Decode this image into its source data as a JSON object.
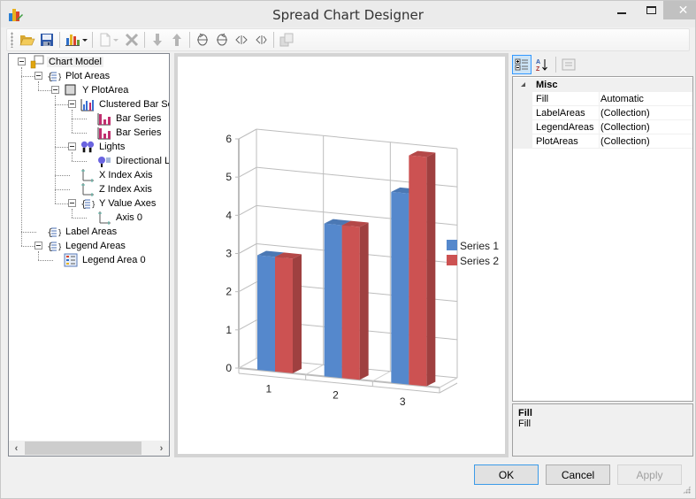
{
  "window": {
    "title": "Spread Chart Designer",
    "close_glyph": "✕"
  },
  "toolbar": {
    "items": [
      {
        "icon": "open-folder-icon",
        "enabled": true
      },
      {
        "icon": "save-icon",
        "enabled": true
      },
      {
        "icon": "chart-type-icon",
        "enabled": true,
        "dropdown": true
      },
      {
        "icon": "new-document-icon",
        "enabled": false,
        "dropdown": true
      },
      {
        "icon": "delete-icon",
        "enabled": false
      },
      {
        "icon": "move-down-icon",
        "enabled": false
      },
      {
        "icon": "move-up-icon",
        "enabled": false
      },
      {
        "icon": "rotate-x-down-icon",
        "enabled": true
      },
      {
        "icon": "rotate-x-up-icon",
        "enabled": true
      },
      {
        "icon": "rotate-y-left-icon",
        "enabled": true
      },
      {
        "icon": "rotate-y-right-icon",
        "enabled": true
      },
      {
        "icon": "copy-layout-icon",
        "enabled": false
      }
    ]
  },
  "tree": {
    "nodes": [
      {
        "label": "Chart Model",
        "icon": "chart-model-icon",
        "level": 0,
        "expanded": true,
        "selected": true
      },
      {
        "label": "Plot Areas",
        "icon": "collection-icon",
        "level": 1,
        "expanded": true
      },
      {
        "label": "Y PlotArea",
        "icon": "plot-area-icon",
        "level": 2,
        "expanded": true
      },
      {
        "label": "Clustered Bar Se",
        "icon": "clustered-bar-icon",
        "level": 3,
        "expanded": true
      },
      {
        "label": "Bar Series",
        "icon": "bar-series-icon",
        "level": 4
      },
      {
        "label": "Bar Series",
        "icon": "bar-series-icon",
        "level": 4
      },
      {
        "label": "Lights",
        "icon": "lights-icon",
        "level": 3,
        "expanded": true
      },
      {
        "label": "Directional Li",
        "icon": "directional-light-icon",
        "level": 4
      },
      {
        "label": "X Index Axis",
        "icon": "axis-icon",
        "level": 3
      },
      {
        "label": "Z Index Axis",
        "icon": "axis-icon",
        "level": 3
      },
      {
        "label": "Y Value Axes",
        "icon": "collection-icon",
        "level": 3,
        "expanded": true
      },
      {
        "label": "Axis 0",
        "icon": "axis-icon",
        "level": 4
      },
      {
        "label": "Label Areas",
        "icon": "collection-icon",
        "level": 1
      },
      {
        "label": "Legend Areas",
        "icon": "collection-icon",
        "level": 1,
        "expanded": true
      },
      {
        "label": "Legend Area 0",
        "icon": "legend-area-icon",
        "level": 2
      }
    ],
    "scroll_left": "‹",
    "scroll_right": "›"
  },
  "chart_data": {
    "type": "bar",
    "style": "3d-clustered-column",
    "categories": [
      "1",
      "2",
      "3"
    ],
    "series": [
      {
        "name": "Series 1",
        "values": [
          3,
          4,
          5
        ],
        "color": "#5588cc"
      },
      {
        "name": "Series 2",
        "values": [
          3,
          4,
          6
        ],
        "color": "#cc5252"
      }
    ],
    "yticks": [
      "0",
      "1",
      "2",
      "3",
      "4",
      "5",
      "6"
    ],
    "ylim": [
      0,
      6
    ],
    "title": "",
    "xlabel": "",
    "ylabel": "",
    "grid": true,
    "legend": "right"
  },
  "properties": {
    "category": "Misc",
    "rows": [
      {
        "name": "Fill",
        "value": "Automatic"
      },
      {
        "name": "LabelAreas",
        "value": "(Collection)"
      },
      {
        "name": "LegendAreas",
        "value": "(Collection)"
      },
      {
        "name": "PlotAreas",
        "value": "(Collection)"
      }
    ],
    "description_title": "Fill",
    "description_text": "Fill"
  },
  "buttons": {
    "ok": "OK",
    "cancel": "Cancel",
    "apply": "Apply"
  }
}
